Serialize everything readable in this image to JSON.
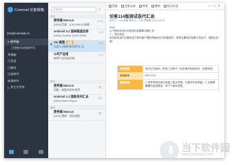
{
  "app": {
    "name": "Coremail 论客邮箱"
  },
  "account": {
    "email": "Zoe@coremail.cn"
  },
  "nav": [
    {
      "label": "收件箱",
      "level": 0
    },
    {
      "label": "已经给Gh的邮件列",
      "level": 1
    },
    {
      "label": "草稿箱",
      "level": 0
    },
    {
      "label": "已发送",
      "level": 0
    },
    {
      "label": "已删除",
      "level": 0
    },
    {
      "label": "垃圾邮件",
      "level": 0
    },
    {
      "label": "病毒邮件",
      "level": 0
    },
    {
      "label": "其它文件夹",
      "level": 0
    }
  ],
  "search": {
    "placeholder": "搜索邮件"
  },
  "list_sections": [
    "今天",
    "昨天",
    "更早"
  ],
  "mails": [
    {
      "from": "麦柯楠 Marcus",
      "subject": "[JIRA] 回复：(CM-16613) 新建...",
      "time": "10:23"
    },
    {
      "from": "Android 3.1 版邮箱速览表",
      "subject": "[JIRA] Created: (CAS-3345)",
      "time": "9:48"
    },
    {
      "from": "Viv 黄莹",
      "subject": "论客114版新测试迭代汇总",
      "time": "9:32",
      "tag": "重要"
    },
    {
      "from": "公司产品组",
      "subject": "每周产品动态总结",
      "time": "9:11"
    },
    {
      "from": "麦柯楠 Marcus",
      "subject": "回复：新版本发布说明",
      "time": "周二"
    },
    {
      "from": "Android 1.3 版新发布汇总",
      "subject": "[JIRA] Sheet Report",
      "time": "周二"
    },
    {
      "from": "麦柯楠 Marcus",
      "subject": "[JIRA] 更新：测试进度",
      "time": "周一"
    }
  ],
  "toolbar": [
    "回复",
    "回复全部",
    "转发",
    "删除",
    "标记未读"
  ],
  "reader": {
    "title": "论客114版测试迭代汇总",
    "meta": "发件人：Viv 黄莹   收件人：Zoe 郑丽晖   2015-10-12",
    "greeting": "Hi all",
    "body": [
      "以下是本次迭代中的测试结果和问题汇总：",
      "一、测试总结",
      "本次版本迭代主要完成了邮件客户端的界面优化与性能提升，现将主要测试结果汇总如下，请各位查阅。"
    ],
    "table": [
      {
        "key": "测试范围",
        "value": "迭代中文版本、完成二次迭代（安全相关功能测试、日程测试）"
      },
      {
        "key": "测试版本",
        "value": "IOS 2.0.5"
      },
      {
        "key": "遗留问题",
        "value": "1. 附件预览在部分机型上显示异常，已提交开发修复；2. 日程提醒偶尔延迟推送，待下一版本处理。"
      }
    ]
  },
  "watermark": {
    "cn": "当下软件园",
    "en": "www.downxia.com"
  }
}
